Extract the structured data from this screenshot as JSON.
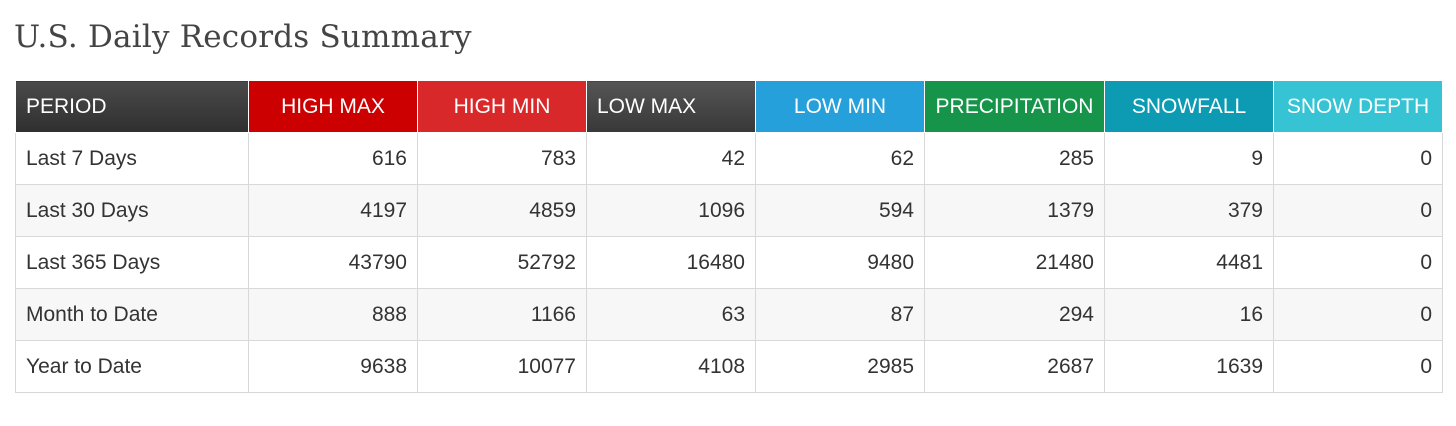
{
  "title": "U.S. Daily Records Summary",
  "table": {
    "columns": [
      {
        "label": "PERIOD",
        "color": "#3a3a3a"
      },
      {
        "label": "HIGH MAX",
        "color": "#cc0000"
      },
      {
        "label": "HIGH MIN",
        "color": "#d9282a"
      },
      {
        "label": "LOW MAX",
        "color": "#444444"
      },
      {
        "label": "LOW MIN",
        "color": "#26a0da"
      },
      {
        "label": "PRECIPITATION",
        "color": "#15944a"
      },
      {
        "label": "SNOWFALL",
        "color": "#0d9bb3"
      },
      {
        "label": "SNOW DEPTH",
        "color": "#36c3d3"
      }
    ],
    "rows": [
      {
        "period": "Last 7 Days",
        "values": [
          "616",
          "783",
          "42",
          "62",
          "285",
          "9",
          "0"
        ]
      },
      {
        "period": "Last 30 Days",
        "values": [
          "4197",
          "4859",
          "1096",
          "594",
          "1379",
          "379",
          "0"
        ]
      },
      {
        "period": "Last 365 Days",
        "values": [
          "43790",
          "52792",
          "16480",
          "9480",
          "21480",
          "4481",
          "0"
        ]
      },
      {
        "period": "Month to Date",
        "values": [
          "888",
          "1166",
          "63",
          "87",
          "294",
          "16",
          "0"
        ]
      },
      {
        "period": "Year to Date",
        "values": [
          "9638",
          "10077",
          "4108",
          "2985",
          "2687",
          "1639",
          "0"
        ]
      }
    ]
  }
}
